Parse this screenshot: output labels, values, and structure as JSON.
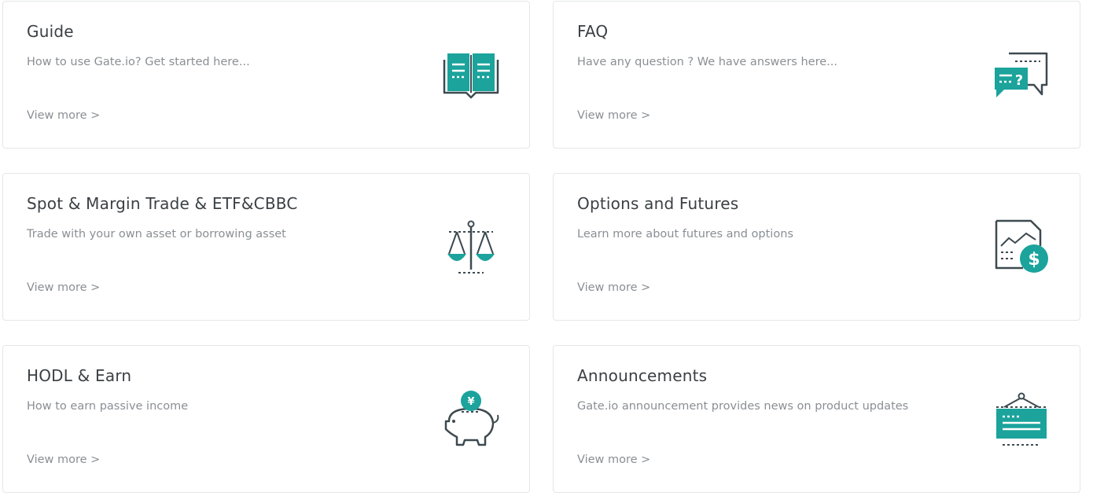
{
  "colors": {
    "accent": "#1ba39c",
    "dark": "#3d4a50",
    "title": "#3b4044",
    "muted": "#8a8f94",
    "border": "#e4e6e8"
  },
  "cards": [
    {
      "title": "Guide",
      "description": "How to use Gate.io? Get started here...",
      "link": "View more >",
      "icon": "open-book-icon"
    },
    {
      "title": "FAQ",
      "description": "Have any question ? We have answers here...",
      "link": "View more >",
      "icon": "question-chat-icon"
    },
    {
      "title": "Spot & Margin Trade & ETF&CBBC",
      "description": "Trade with your own asset or borrowing asset",
      "link": "View more >",
      "icon": "balance-scale-icon"
    },
    {
      "title": "Options and Futures",
      "description": "Learn more about futures and options",
      "link": "View more >",
      "icon": "chart-dollar-icon"
    },
    {
      "title": "HODL & Earn",
      "description": "How to earn passive income",
      "link": "View more >",
      "icon": "piggy-bank-icon"
    },
    {
      "title": "Announcements",
      "description": "Gate.io announcement provides news on product updates",
      "link": "View more >",
      "icon": "notice-board-icon"
    }
  ]
}
